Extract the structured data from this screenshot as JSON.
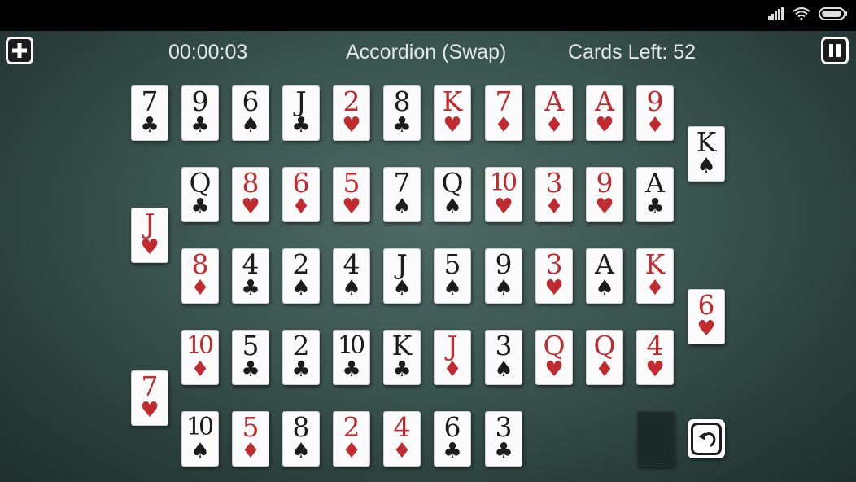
{
  "hud": {
    "timer": "00:00:03",
    "title": "Accordion (Swap)",
    "cards_left": "Cards Left: 52"
  },
  "icons": {
    "menu": "plus-icon",
    "pause": "pause-icon",
    "undo": "undo-icon",
    "signal": "signal-icon",
    "wifi": "wifi-icon",
    "battery": "battery-icon"
  },
  "colors": {
    "red_suit": "#c12a2f",
    "black_suit": "#1c1c1c",
    "felt": "#3a5450"
  },
  "cards": [
    {
      "rank": "7",
      "suit": "♣",
      "color": "black"
    },
    {
      "rank": "9",
      "suit": "♣",
      "color": "black"
    },
    {
      "rank": "6",
      "suit": "♠",
      "color": "black"
    },
    {
      "rank": "J",
      "suit": "♣",
      "color": "black"
    },
    {
      "rank": "2",
      "suit": "♥",
      "color": "red"
    },
    {
      "rank": "8",
      "suit": "♣",
      "color": "black"
    },
    {
      "rank": "K",
      "suit": "♥",
      "color": "red"
    },
    {
      "rank": "7",
      "suit": "♦",
      "color": "red"
    },
    {
      "rank": "A",
      "suit": "♦",
      "color": "red"
    },
    {
      "rank": "A",
      "suit": "♥",
      "color": "red"
    },
    {
      "rank": "9",
      "suit": "♦",
      "color": "red"
    },
    {
      "rank": "K",
      "suit": "♠",
      "color": "black"
    },
    {
      "rank": "A",
      "suit": "♣",
      "color": "black"
    },
    {
      "rank": "9",
      "suit": "♥",
      "color": "red"
    },
    {
      "rank": "3",
      "suit": "♦",
      "color": "red"
    },
    {
      "rank": "10",
      "suit": "♥",
      "color": "red"
    },
    {
      "rank": "Q",
      "suit": "♠",
      "color": "black"
    },
    {
      "rank": "7",
      "suit": "♠",
      "color": "black"
    },
    {
      "rank": "5",
      "suit": "♥",
      "color": "red"
    },
    {
      "rank": "6",
      "suit": "♦",
      "color": "red"
    },
    {
      "rank": "8",
      "suit": "♥",
      "color": "red"
    },
    {
      "rank": "Q",
      "suit": "♣",
      "color": "black"
    },
    {
      "rank": "J",
      "suit": "♥",
      "color": "red"
    },
    {
      "rank": "8",
      "suit": "♦",
      "color": "red"
    },
    {
      "rank": "4",
      "suit": "♣",
      "color": "black"
    },
    {
      "rank": "2",
      "suit": "♠",
      "color": "black"
    },
    {
      "rank": "4",
      "suit": "♠",
      "color": "black"
    },
    {
      "rank": "J",
      "suit": "♠",
      "color": "black"
    },
    {
      "rank": "5",
      "suit": "♠",
      "color": "black"
    },
    {
      "rank": "9",
      "suit": "♠",
      "color": "black"
    },
    {
      "rank": "3",
      "suit": "♥",
      "color": "red"
    },
    {
      "rank": "A",
      "suit": "♠",
      "color": "black"
    },
    {
      "rank": "K",
      "suit": "♦",
      "color": "red"
    },
    {
      "rank": "6",
      "suit": "♥",
      "color": "red"
    },
    {
      "rank": "4",
      "suit": "♥",
      "color": "red"
    },
    {
      "rank": "Q",
      "suit": "♦",
      "color": "red"
    },
    {
      "rank": "Q",
      "suit": "♥",
      "color": "red"
    },
    {
      "rank": "3",
      "suit": "♠",
      "color": "black"
    },
    {
      "rank": "J",
      "suit": "♦",
      "color": "red"
    },
    {
      "rank": "K",
      "suit": "♣",
      "color": "black"
    },
    {
      "rank": "10",
      "suit": "♣",
      "color": "black"
    },
    {
      "rank": "2",
      "suit": "♣",
      "color": "black"
    },
    {
      "rank": "5",
      "suit": "♣",
      "color": "black"
    },
    {
      "rank": "10",
      "suit": "♦",
      "color": "red"
    },
    {
      "rank": "7",
      "suit": "♥",
      "color": "red"
    },
    {
      "rank": "10",
      "suit": "♠",
      "color": "black"
    },
    {
      "rank": "5",
      "suit": "♦",
      "color": "red"
    },
    {
      "rank": "8",
      "suit": "♠",
      "color": "black"
    },
    {
      "rank": "2",
      "suit": "♦",
      "color": "red"
    },
    {
      "rank": "4",
      "suit": "♦",
      "color": "red"
    },
    {
      "rank": "6",
      "suit": "♣",
      "color": "black"
    },
    {
      "rank": "3",
      "suit": "♣",
      "color": "black"
    }
  ]
}
